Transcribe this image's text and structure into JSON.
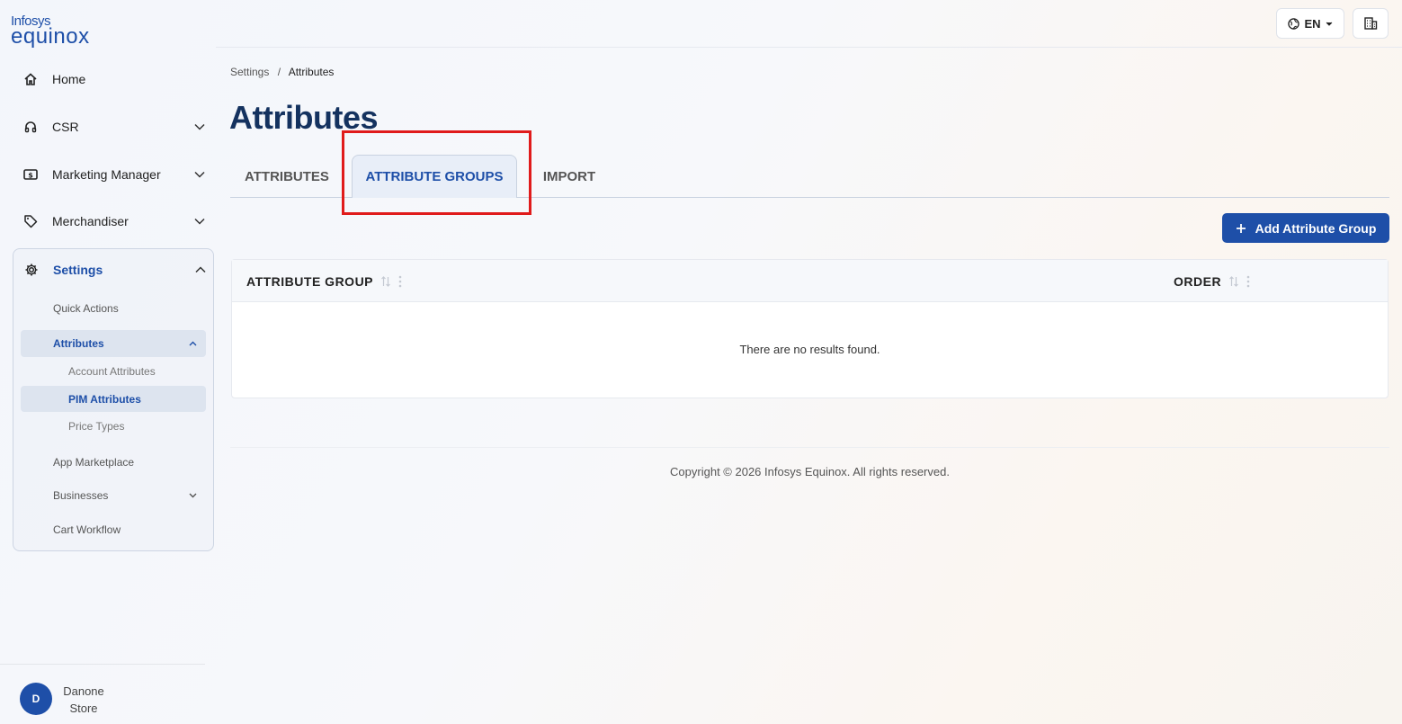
{
  "brand": {
    "line1": "Infosys",
    "line2": "equinox"
  },
  "sidebar": {
    "items": [
      {
        "label": "Home",
        "icon": "home-icon"
      },
      {
        "label": "CSR",
        "icon": "headset-icon"
      },
      {
        "label": "Marketing Manager",
        "icon": "dollar-icon"
      },
      {
        "label": "Merchandiser",
        "icon": "tag-icon"
      }
    ],
    "settings": {
      "label": "Settings",
      "icon": "gear-icon",
      "children": [
        {
          "label": "Quick Actions"
        },
        {
          "label": "Attributes"
        },
        {
          "label": "App Marketplace"
        },
        {
          "label": "Businesses"
        },
        {
          "label": "Cart Workflow"
        }
      ],
      "attributes_children": [
        {
          "label": "Account Attributes"
        },
        {
          "label": "PIM Attributes"
        },
        {
          "label": "Price Types"
        }
      ]
    },
    "user": {
      "initial": "D",
      "name": "Danone Store"
    }
  },
  "topbar": {
    "language": "EN"
  },
  "breadcrumb": {
    "parent": "Settings",
    "separator": "/",
    "current": "Attributes"
  },
  "page": {
    "title": "Attributes"
  },
  "tabs": [
    {
      "label": "ATTRIBUTES",
      "active": false
    },
    {
      "label": "ATTRIBUTE GROUPS",
      "active": true
    },
    {
      "label": "IMPORT",
      "active": false
    }
  ],
  "actions": {
    "add_label": "Add Attribute Group"
  },
  "table": {
    "columns": [
      "ATTRIBUTE GROUP",
      "ORDER"
    ],
    "empty_message": "There are no results found."
  },
  "footer": {
    "copyright": "Copyright © 2026 Infosys Equinox. All rights reserved."
  },
  "colors": {
    "accent": "#1e4fa8",
    "title": "#14325f",
    "highlight": "#e01b1b"
  }
}
